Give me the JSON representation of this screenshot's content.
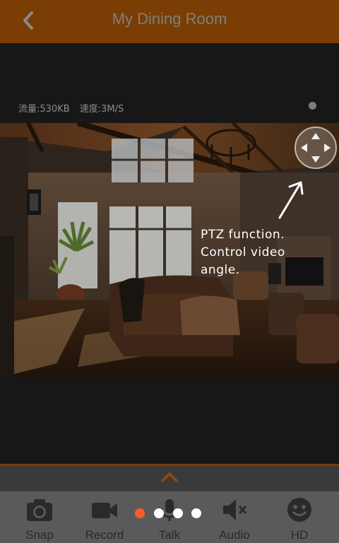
{
  "header": {
    "title": "My Dining Room"
  },
  "stats": {
    "traffic": "流量:530KB",
    "speed": "速度:3M/S"
  },
  "annotation": {
    "lines": [
      "PTZ function.",
      "Control video",
      "angle."
    ]
  },
  "toolbar": {
    "items": [
      {
        "label": "Snap",
        "icon": "camera-icon"
      },
      {
        "label": "Record",
        "icon": "video-camera-icon"
      },
      {
        "label": "Talk",
        "icon": "microphone-icon"
      },
      {
        "label": "Audio",
        "icon": "speaker-mute-icon"
      },
      {
        "label": "HD",
        "icon": "smiley-icon"
      }
    ]
  },
  "pager": {
    "count": 4,
    "active_index": 0
  },
  "colors": {
    "header": "#7a3d04",
    "accent": "#ff5a2c",
    "toolbar": "#5a5a5a"
  }
}
